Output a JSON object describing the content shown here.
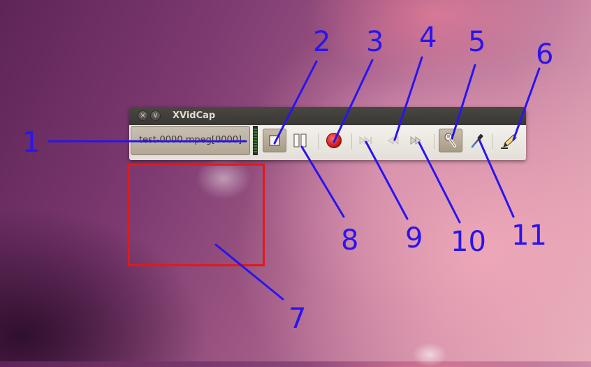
{
  "window": {
    "title": "XVidCap",
    "filename": "test-0000.mpeg[0000]",
    "controls": {
      "close_glyph": "×",
      "minimize_glyph": "∨"
    }
  },
  "toolbar": {
    "buttons": [
      {
        "name": "stop-button",
        "icon": "stop-icon"
      },
      {
        "name": "pause-button",
        "icon": "pause-icon"
      },
      {
        "name": "record-button",
        "icon": "record-icon"
      },
      {
        "name": "step-button",
        "icon": "step-forward-icon"
      },
      {
        "name": "rewind-button",
        "icon": "rewind-icon"
      },
      {
        "name": "fast-forward-button",
        "icon": "fast-forward-icon"
      },
      {
        "name": "select-frame-button",
        "icon": "wrench-icon"
      },
      {
        "name": "pick-color-button",
        "icon": "eyedropper-icon"
      },
      {
        "name": "edit-button",
        "icon": "pencil-icon"
      }
    ]
  },
  "callouts": {
    "c1": "1",
    "c2": "2",
    "c3": "3",
    "c4": "4",
    "c5": "5",
    "c6": "6",
    "c7": "7",
    "c8": "8",
    "c9": "9",
    "c10": "10",
    "c11": "11"
  },
  "colors": {
    "annotation": "#2a14ee",
    "capture_frame": "#e01a1a",
    "record": "#d81818"
  }
}
